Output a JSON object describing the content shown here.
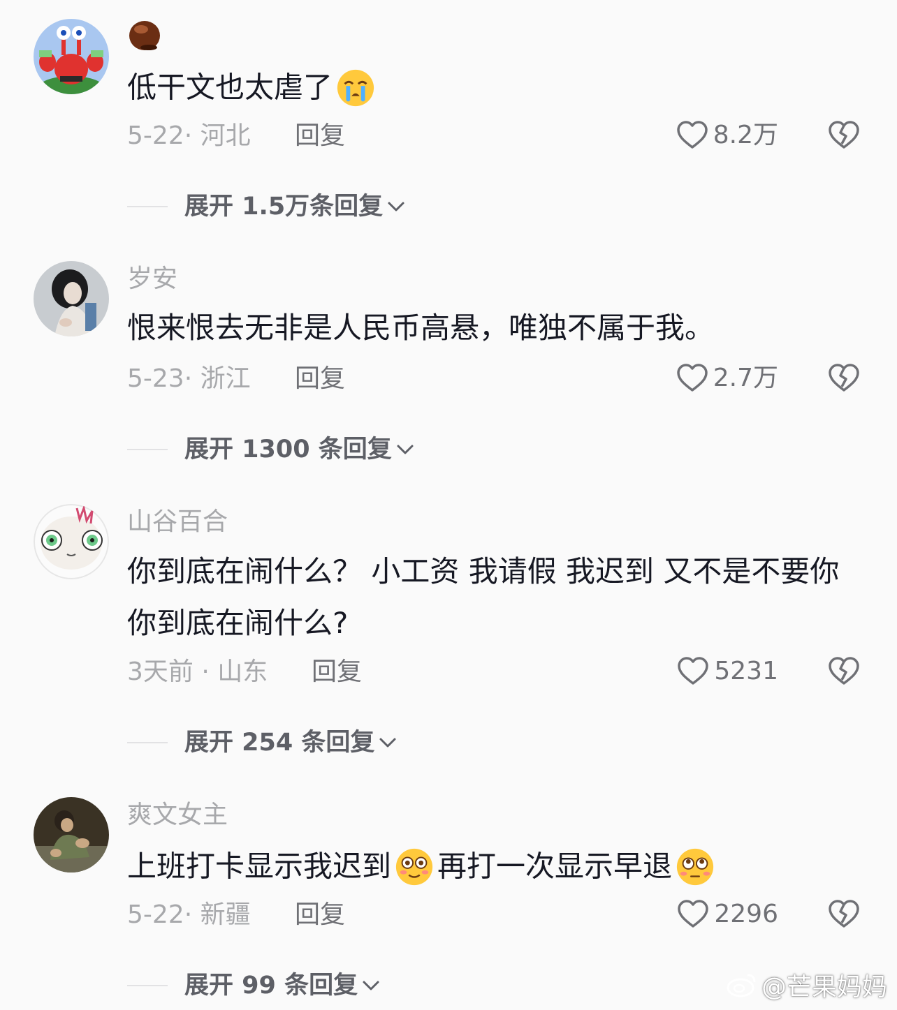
{
  "comments": [
    {
      "username": "",
      "text_before_emoji": "低干文也太虐了",
      "text_after_emoji": "",
      "emoji": "crying-emoji",
      "date": "5-22",
      "location": "河北",
      "reply_label": "回复",
      "likes": "8.2万",
      "expand_label": "展开 1.5万条回复"
    },
    {
      "username": "岁安",
      "text": "恨来恨去无非是人民币高悬，唯独不属于我。",
      "date": "5-23",
      "location": "浙江",
      "reply_label": "回复",
      "likes": "2.7万",
      "expand_label": "展开 1300 条回复"
    },
    {
      "username": "山谷百合",
      "text": "你到底在闹什么？ 小工资 我请假 我迟到 又不是不要你 你到底在闹什么?",
      "date": "3天前",
      "location": "山东",
      "reply_label": "回复",
      "likes": "5231",
      "expand_label": "展开 254 条回复"
    },
    {
      "username": "爽文女主",
      "text_part1": "上班打卡显示我迟到",
      "text_part2": "再打一次显示早退",
      "date": "5-22",
      "location": "新疆",
      "reply_label": "回复",
      "likes": "2296",
      "expand_label": "展开 99 条回复"
    }
  ],
  "watermark": "@芒果妈妈",
  "icons": {
    "like": "heart-outline-icon",
    "dislike": "broken-heart-icon",
    "expand": "chevron-down-icon"
  },
  "colors": {
    "background": "#fafafa",
    "text": "#161823",
    "secondary": "#a7a8ab",
    "action": "#6f7075"
  }
}
